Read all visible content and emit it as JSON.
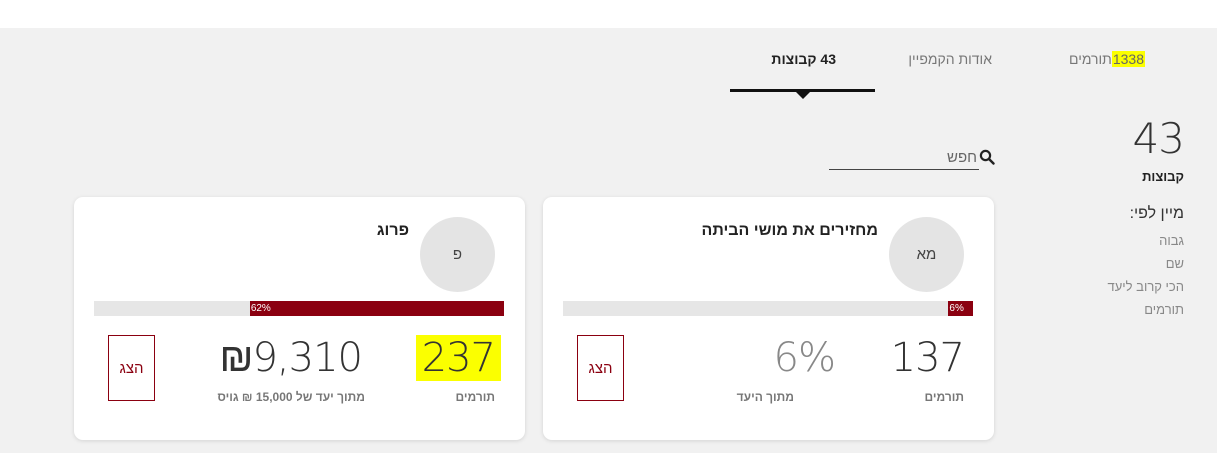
{
  "tabs": {
    "donors_count": "1338",
    "donors_label": "תורמים",
    "about": "אודות הקמפיין",
    "teams": "43 קבוצות"
  },
  "search": {
    "placeholder": "חפש"
  },
  "sidebar": {
    "count": "43",
    "count_label": "קבוצות",
    "sort_title": "מיין לפי:",
    "sort_options": [
      "גבוה",
      "שם",
      "הכי קרוב ליעד",
      "תורמים"
    ]
  },
  "cards": [
    {
      "avatar": "מא",
      "name": "מחזירים את מושי הביתה",
      "progress_pct": 6,
      "progress_label": "6%",
      "donors": "137",
      "donors_label": "תורמים",
      "goal_value": "6%",
      "goal_label": "מתוך היעד",
      "show_label": "הצג"
    },
    {
      "avatar": "פ",
      "name": "פרוג",
      "progress_pct": 62,
      "progress_label": "62%",
      "donors": "237",
      "donors_label": "תורמים",
      "raised_value": "₪9,310",
      "raised_label": "מתוך יעד של 15,000 ₪ גויס",
      "show_label": "הצג"
    }
  ],
  "colors": {
    "accent": "#8b0010",
    "highlight": "#fbff00",
    "background": "#f1f1f1"
  }
}
